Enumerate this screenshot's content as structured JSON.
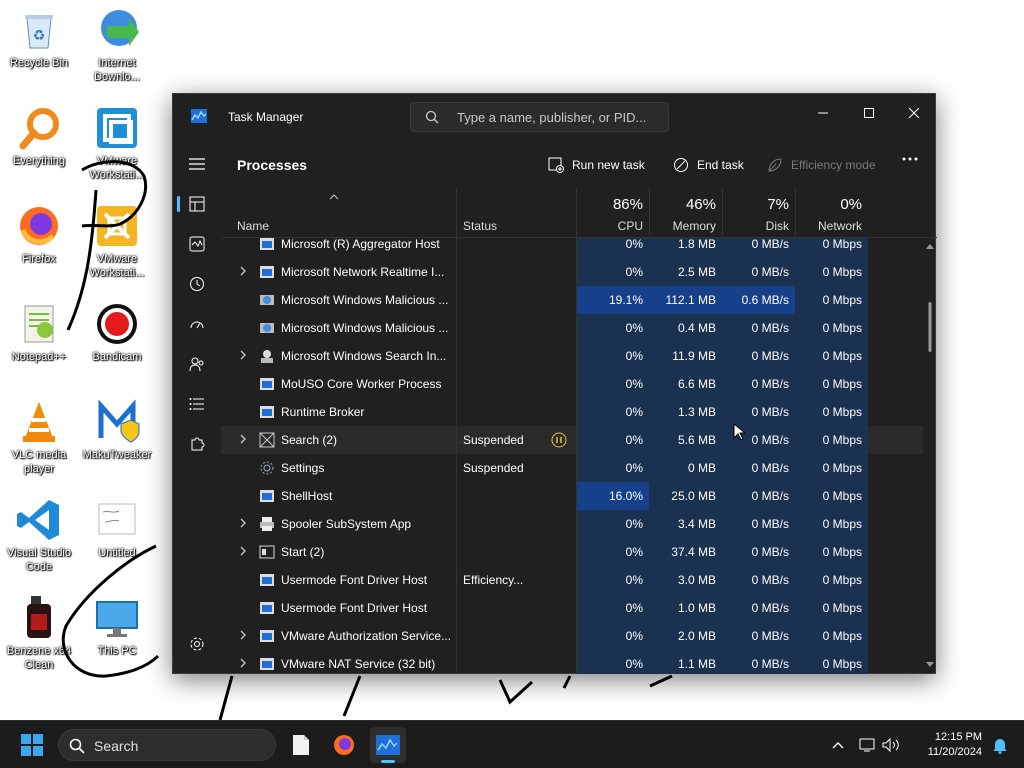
{
  "desktop": {
    "icons": [
      {
        "label": "Recycle Bin",
        "icon": "recycle-bin-icon"
      },
      {
        "label": "Internet Downlo...",
        "icon": "idm-icon"
      },
      {
        "label": "Everything",
        "icon": "everything-icon"
      },
      {
        "label": "VMware Workstati...",
        "icon": "vmware-icon"
      },
      {
        "label": "Firefox",
        "icon": "firefox-icon"
      },
      {
        "label": "VMware Workstati...",
        "icon": "vmware-player-icon"
      },
      {
        "label": "Notepad++",
        "icon": "notepadpp-icon"
      },
      {
        "label": "Bandicam",
        "icon": "bandicam-icon"
      },
      {
        "label": "VLC media player",
        "icon": "vlc-icon"
      },
      {
        "label": "MakuTweaker",
        "icon": "makutweaker-icon"
      },
      {
        "label": "Visual Studio Code",
        "icon": "vscode-icon"
      },
      {
        "label": "Untitled",
        "icon": "paint-file-icon"
      },
      {
        "label": "Benzene x64 Clean",
        "icon": "benzene-icon"
      },
      {
        "label": "This PC",
        "icon": "this-pc-icon"
      }
    ]
  },
  "window": {
    "title": "Task Manager",
    "search_placeholder": "Type a name, publisher, or PID...",
    "page_title": "Processes",
    "commands": {
      "run_new_task": "Run new task",
      "end_task": "End task",
      "efficiency_mode": "Efficiency mode"
    },
    "columns": {
      "name": "Name",
      "status": "Status",
      "cpu": {
        "pct": "86%",
        "label": "CPU"
      },
      "memory": {
        "pct": "46%",
        "label": "Memory"
      },
      "disk": {
        "pct": "7%",
        "label": "Disk"
      },
      "network": {
        "pct": "0%",
        "label": "Network"
      }
    },
    "rows": [
      {
        "name": "Microsoft (R) Aggregator Host",
        "status": "",
        "cpu": "0%",
        "memory": "1.8 MB",
        "disk": "0 MB/s",
        "network": "0 Mbps",
        "expand": false
      },
      {
        "name": "Microsoft Network Realtime I...",
        "status": "",
        "cpu": "0%",
        "memory": "2.5 MB",
        "disk": "0 MB/s",
        "network": "0 Mbps",
        "expand": true
      },
      {
        "name": "Microsoft Windows Malicious ...",
        "status": "",
        "cpu": "19.1%",
        "memory": "112.1 MB",
        "disk": "0.6 MB/s",
        "network": "0 Mbps",
        "expand": false
      },
      {
        "name": "Microsoft Windows Malicious ...",
        "status": "",
        "cpu": "0%",
        "memory": "0.4 MB",
        "disk": "0 MB/s",
        "network": "0 Mbps",
        "expand": false
      },
      {
        "name": "Microsoft Windows Search In...",
        "status": "",
        "cpu": "0%",
        "memory": "11.9 MB",
        "disk": "0 MB/s",
        "network": "0 Mbps",
        "expand": true
      },
      {
        "name": "MoUSO Core Worker Process",
        "status": "",
        "cpu": "0%",
        "memory": "6.6 MB",
        "disk": "0 MB/s",
        "network": "0 Mbps",
        "expand": false
      },
      {
        "name": "Runtime Broker",
        "status": "",
        "cpu": "0%",
        "memory": "1.3 MB",
        "disk": "0 MB/s",
        "network": "0 Mbps",
        "expand": false
      },
      {
        "name": "Search (2)",
        "status": "Suspended",
        "cpu": "0%",
        "memory": "5.6 MB",
        "disk": "0 MB/s",
        "network": "0 Mbps",
        "expand": true
      },
      {
        "name": "Settings",
        "status": "Suspended",
        "cpu": "0%",
        "memory": "0 MB",
        "disk": "0 MB/s",
        "network": "0 Mbps",
        "expand": false
      },
      {
        "name": "ShellHost",
        "status": "",
        "cpu": "16.0%",
        "memory": "25.0 MB",
        "disk": "0 MB/s",
        "network": "0 Mbps",
        "expand": false
      },
      {
        "name": "Spooler SubSystem App",
        "status": "",
        "cpu": "0%",
        "memory": "3.4 MB",
        "disk": "0 MB/s",
        "network": "0 Mbps",
        "expand": true
      },
      {
        "name": "Start (2)",
        "status": "",
        "cpu": "0%",
        "memory": "37.4 MB",
        "disk": "0 MB/s",
        "network": "0 Mbps",
        "expand": true
      },
      {
        "name": "Usermode Font Driver Host",
        "status": "Efficiency...",
        "cpu": "0%",
        "memory": "3.0 MB",
        "disk": "0 MB/s",
        "network": "0 Mbps",
        "expand": false
      },
      {
        "name": "Usermode Font Driver Host",
        "status": "",
        "cpu": "0%",
        "memory": "1.0 MB",
        "disk": "0 MB/s",
        "network": "0 Mbps",
        "expand": false
      },
      {
        "name": "VMware Authorization Service...",
        "status": "",
        "cpu": "0%",
        "memory": "2.0 MB",
        "disk": "0 MB/s",
        "network": "0 Mbps",
        "expand": true
      },
      {
        "name": "VMware NAT Service (32 bit)",
        "status": "",
        "cpu": "0%",
        "memory": "1.1 MB",
        "disk": "0 MB/s",
        "network": "0 Mbps",
        "expand": true
      }
    ]
  },
  "taskbar": {
    "search_label": "Search",
    "time": "12:15 PM",
    "date": "11/20/2024"
  },
  "colors": {
    "accent": "#4cc2ff",
    "heat_low": "#1b3150",
    "heat_high": "#17408a"
  }
}
